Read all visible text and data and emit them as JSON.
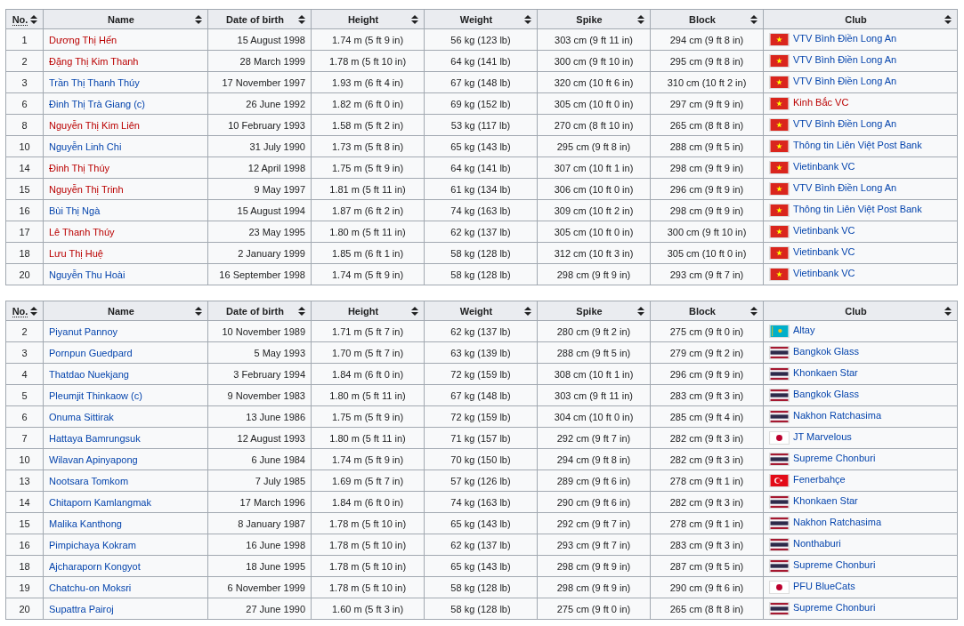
{
  "tables": [
    {
      "columns": [
        {
          "label": "No.",
          "abbr": true
        },
        {
          "label": "Name",
          "abbr": false
        },
        {
          "label": "Date of birth",
          "abbr": false
        },
        {
          "label": "Height",
          "abbr": false
        },
        {
          "label": "Weight",
          "abbr": false
        },
        {
          "label": "Spike",
          "abbr": false
        },
        {
          "label": "Block",
          "abbr": false
        },
        {
          "label": "Club",
          "abbr": false
        }
      ],
      "rows": [
        {
          "no": "1",
          "name": "Dương Thị Hến",
          "name_missing": true,
          "dob": "15 August 1998",
          "height": "1.74 m (5 ft 9 in)",
          "weight": "56 kg (123 lb)",
          "spike": "303 cm (9 ft 11 in)",
          "block": "294 cm (9 ft 8 in)",
          "kind": "vn",
          "club": "VTV Bình Điền Long An",
          "club_missing": false
        },
        {
          "no": "2",
          "name": "Đặng Thị Kim Thanh",
          "name_missing": true,
          "dob": "28 March 1999",
          "height": "1.78 m (5 ft 10 in)",
          "weight": "64 kg (141 lb)",
          "spike": "300 cm (9 ft 10 in)",
          "block": "295 cm (9 ft 8 in)",
          "kind": "vn",
          "club": "VTV Bình Điền Long An",
          "club_missing": false
        },
        {
          "no": "3",
          "name": "Trần Thị Thanh Thúy",
          "name_missing": false,
          "dob": "17 November 1997",
          "height": "1.93 m (6 ft 4 in)",
          "weight": "67 kg (148 lb)",
          "spike": "320 cm (10 ft 6 in)",
          "block": "310 cm (10 ft 2 in)",
          "kind": "vn",
          "club": "VTV Bình Điền Long An",
          "club_missing": false
        },
        {
          "no": "6",
          "name": "Đinh Thị Trà Giang (c)",
          "name_missing": false,
          "dob": "26 June 1992",
          "height": "1.82 m (6 ft 0 in)",
          "weight": "69 kg (152 lb)",
          "spike": "305 cm (10 ft 0 in)",
          "block": "297 cm (9 ft 9 in)",
          "kind": "vn",
          "club": "Kinh Bắc VC",
          "club_missing": true
        },
        {
          "no": "8",
          "name": "Nguyễn Thị Kim Liên",
          "name_missing": true,
          "dob": "10 February 1993",
          "height": "1.58 m (5 ft 2 in)",
          "weight": "53 kg (117 lb)",
          "spike": "270 cm (8 ft 10 in)",
          "block": "265 cm (8 ft 8 in)",
          "kind": "vn",
          "club": "VTV Bình Điền Long An",
          "club_missing": false
        },
        {
          "no": "10",
          "name": "Nguyễn Linh Chi",
          "name_missing": false,
          "dob": "31 July 1990",
          "height": "1.73 m (5 ft 8 in)",
          "weight": "65 kg (143 lb)",
          "spike": "295 cm (9 ft 8 in)",
          "block": "288 cm (9 ft 5 in)",
          "kind": "vn",
          "club": "Thông tin Liên Việt Post Bank",
          "club_missing": false
        },
        {
          "no": "14",
          "name": "Đinh Thị Thúy",
          "name_missing": true,
          "dob": "12 April 1998",
          "height": "1.75 m (5 ft 9 in)",
          "weight": "64 kg (141 lb)",
          "spike": "307 cm (10 ft 1 in)",
          "block": "298 cm (9 ft 9 in)",
          "kind": "vn",
          "club": "Vietinbank VC",
          "club_missing": false
        },
        {
          "no": "15",
          "name": "Nguyễn Thị Trinh",
          "name_missing": true,
          "dob": "9 May 1997",
          "height": "1.81 m (5 ft 11 in)",
          "weight": "61 kg (134 lb)",
          "spike": "306 cm (10 ft 0 in)",
          "block": "296 cm (9 ft 9 in)",
          "kind": "vn",
          "club": "VTV Bình Điền Long An",
          "club_missing": false
        },
        {
          "no": "16",
          "name": "Bùi Thị Ngà",
          "name_missing": false,
          "dob": "15 August 1994",
          "height": "1.87 m (6 ft 2 in)",
          "weight": "74 kg (163 lb)",
          "spike": "309 cm (10 ft 2 in)",
          "block": "298 cm (9 ft 9 in)",
          "kind": "vn",
          "club": "Thông tin Liên Việt Post Bank",
          "club_missing": false
        },
        {
          "no": "17",
          "name": "Lê Thanh Thúy",
          "name_missing": true,
          "dob": "23 May 1995",
          "height": "1.80 m (5 ft 11 in)",
          "weight": "62 kg (137 lb)",
          "spike": "305 cm (10 ft 0 in)",
          "block": "300 cm (9 ft 10 in)",
          "kind": "vn",
          "club": "Vietinbank VC",
          "club_missing": false
        },
        {
          "no": "18",
          "name": "Lưu Thị Huệ",
          "name_missing": true,
          "dob": "2 January 1999",
          "height": "1.85 m (6 ft 1 in)",
          "weight": "58 kg (128 lb)",
          "spike": "312 cm (10 ft 3 in)",
          "block": "305 cm (10 ft 0 in)",
          "kind": "vn",
          "club": "Vietinbank VC",
          "club_missing": false
        },
        {
          "no": "20",
          "name": "Nguyễn Thu Hoài",
          "name_missing": false,
          "dob": "16 September 1998",
          "height": "1.74 m (5 ft 9 in)",
          "weight": "58 kg (128 lb)",
          "spike": "298 cm (9 ft 9 in)",
          "block": "293 cm (9 ft 7 in)",
          "kind": "vn",
          "club": "Vietinbank VC",
          "club_missing": false
        }
      ]
    },
    {
      "columns": [
        {
          "label": "No.",
          "abbr": true
        },
        {
          "label": "Name",
          "abbr": false
        },
        {
          "label": "Date of birth",
          "abbr": false
        },
        {
          "label": "Height",
          "abbr": false
        },
        {
          "label": "Weight",
          "abbr": false
        },
        {
          "label": "Spike",
          "abbr": false
        },
        {
          "label": "Block",
          "abbr": false
        },
        {
          "label": "Club",
          "abbr": false
        }
      ],
      "rows": [
        {
          "no": "2",
          "name": "Piyanut Pannoy",
          "name_missing": false,
          "dob": "10 November 1989",
          "height": "1.71 m (5 ft 7 in)",
          "weight": "62 kg (137 lb)",
          "spike": "280 cm (9 ft 2 in)",
          "block": "275 cm (9 ft 0 in)",
          "kind": "kz",
          "club": "Altay",
          "club_missing": false
        },
        {
          "no": "3",
          "name": "Pornpun Guedpard",
          "name_missing": false,
          "dob": "5 May 1993",
          "height": "1.70 m (5 ft 7 in)",
          "weight": "63 kg (139 lb)",
          "spike": "288 cm (9 ft 5 in)",
          "block": "279 cm (9 ft 2 in)",
          "kind": "th",
          "club": "Bangkok Glass",
          "club_missing": false
        },
        {
          "no": "4",
          "name": "Thatdao Nuekjang",
          "name_missing": false,
          "dob": "3 February 1994",
          "height": "1.84 m (6 ft 0 in)",
          "weight": "72 kg (159 lb)",
          "spike": "308 cm (10 ft 1 in)",
          "block": "296 cm (9 ft 9 in)",
          "kind": "th",
          "club": "Khonkaen Star",
          "club_missing": false
        },
        {
          "no": "5",
          "name": "Pleumjit Thinkaow (c)",
          "name_missing": false,
          "dob": "9 November 1983",
          "height": "1.80 m (5 ft 11 in)",
          "weight": "67 kg (148 lb)",
          "spike": "303 cm (9 ft 11 in)",
          "block": "283 cm (9 ft 3 in)",
          "kind": "th",
          "club": "Bangkok Glass",
          "club_missing": false
        },
        {
          "no": "6",
          "name": "Onuma Sittirak",
          "name_missing": false,
          "dob": "13 June 1986",
          "height": "1.75 m (5 ft 9 in)",
          "weight": "72 kg (159 lb)",
          "spike": "304 cm (10 ft 0 in)",
          "block": "285 cm (9 ft 4 in)",
          "kind": "th",
          "club": "Nakhon Ratchasima",
          "club_missing": false
        },
        {
          "no": "7",
          "name": "Hattaya Bamrungsuk",
          "name_missing": false,
          "dob": "12 August 1993",
          "height": "1.80 m (5 ft 11 in)",
          "weight": "71 kg (157 lb)",
          "spike": "292 cm (9 ft 7 in)",
          "block": "282 cm (9 ft 3 in)",
          "kind": "jp",
          "club": "JT Marvelous",
          "club_missing": false
        },
        {
          "no": "10",
          "name": "Wilavan Apinyapong",
          "name_missing": false,
          "dob": "6 June 1984",
          "height": "1.74 m (5 ft 9 in)",
          "weight": "70 kg (150 lb)",
          "spike": "294 cm (9 ft 8 in)",
          "block": "282 cm (9 ft 3 in)",
          "kind": "th",
          "club": "Supreme Chonburi",
          "club_missing": false
        },
        {
          "no": "13",
          "name": "Nootsara Tomkom",
          "name_missing": false,
          "dob": "7 July 1985",
          "height": "1.69 m (5 ft 7 in)",
          "weight": "57 kg (126 lb)",
          "spike": "289 cm (9 ft 6 in)",
          "block": "278 cm (9 ft 1 in)",
          "kind": "tr",
          "club": "Fenerbahçe",
          "club_missing": false
        },
        {
          "no": "14",
          "name": "Chitaporn Kamlangmak",
          "name_missing": false,
          "dob": "17 March 1996",
          "height": "1.84 m (6 ft 0 in)",
          "weight": "74 kg (163 lb)",
          "spike": "290 cm (9 ft 6 in)",
          "block": "282 cm (9 ft 3 in)",
          "kind": "th",
          "club": "Khonkaen Star",
          "club_missing": false
        },
        {
          "no": "15",
          "name": "Malika Kanthong",
          "name_missing": false,
          "dob": "8 January 1987",
          "height": "1.78 m (5 ft 10 in)",
          "weight": "65 kg (143 lb)",
          "spike": "292 cm (9 ft 7 in)",
          "block": "278 cm (9 ft 1 in)",
          "kind": "th",
          "club": "Nakhon Ratchasima",
          "club_missing": false
        },
        {
          "no": "16",
          "name": "Pimpichaya Kokram",
          "name_missing": false,
          "dob": "16 June 1998",
          "height": "1.78 m (5 ft 10 in)",
          "weight": "62 kg (137 lb)",
          "spike": "293 cm (9 ft 7 in)",
          "block": "283 cm (9 ft 3 in)",
          "kind": "th",
          "club": "Nonthaburi",
          "club_missing": false
        },
        {
          "no": "18",
          "name": "Ajcharaporn Kongyot",
          "name_missing": false,
          "dob": "18 June 1995",
          "height": "1.78 m (5 ft 10 in)",
          "weight": "65 kg (143 lb)",
          "spike": "298 cm (9 ft 9 in)",
          "block": "287 cm (9 ft 5 in)",
          "kind": "th",
          "club": "Supreme Chonburi",
          "club_missing": false
        },
        {
          "no": "19",
          "name": "Chatchu-on Moksri",
          "name_missing": false,
          "dob": "6 November 1999",
          "height": "1.78 m (5 ft 10 in)",
          "weight": "58 kg (128 lb)",
          "spike": "298 cm (9 ft 9 in)",
          "block": "290 cm (9 ft 6 in)",
          "kind": "jp",
          "club": "PFU BlueCats",
          "club_missing": false
        },
        {
          "no": "20",
          "name": "Supattra Pairoj",
          "name_missing": false,
          "dob": "27 June 1990",
          "height": "1.60 m (5 ft 3 in)",
          "weight": "58 kg (128 lb)",
          "spike": "275 cm (9 ft 0 in)",
          "block": "265 cm (8 ft 8 in)",
          "kind": "th",
          "club": "Supreme Chonburi",
          "club_missing": false
        }
      ]
    }
  ]
}
